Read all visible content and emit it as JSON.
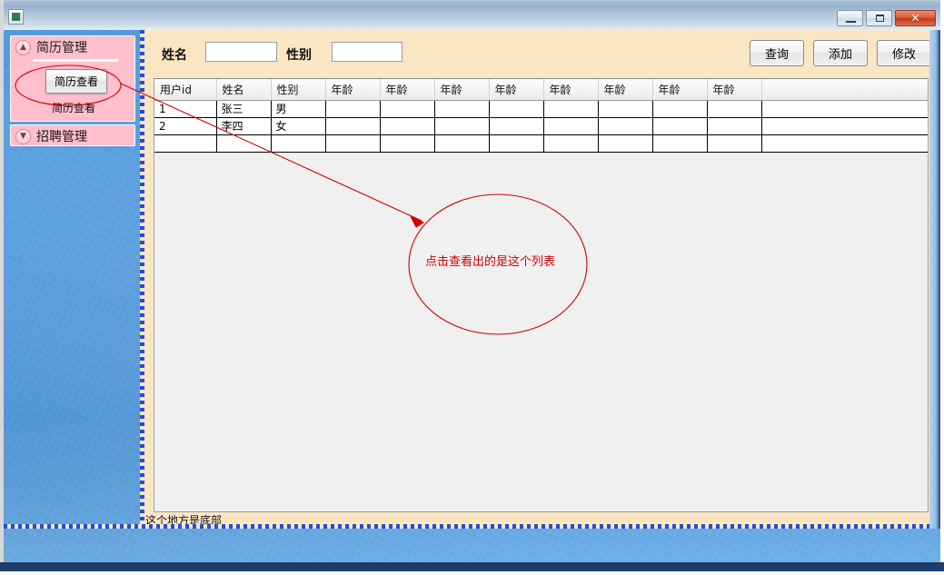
{
  "window": {
    "title": "",
    "icon": "window-app-icon",
    "controls": {
      "minimize": "–",
      "maximize": "□",
      "close": "✕"
    }
  },
  "sidebar": {
    "panels": [
      {
        "id": "resume-management",
        "title": "简历管理",
        "chevron": "▲",
        "expanded": true,
        "button_label": "简历查看",
        "caption_label": "简历查看"
      },
      {
        "id": "recruit-management",
        "title": "招聘管理",
        "chevron": "▼",
        "expanded": false
      }
    ]
  },
  "toolbar": {
    "fields": [
      {
        "label": "姓名",
        "value": "",
        "placeholder": ""
      },
      {
        "label": "性别",
        "value": "",
        "placeholder": ""
      }
    ],
    "buttons": [
      {
        "id": "query",
        "label": "查询"
      },
      {
        "id": "add",
        "label": "添加"
      },
      {
        "id": "edit",
        "label": "修改"
      }
    ]
  },
  "grid": {
    "columns": [
      {
        "key": "userid",
        "label": "用户id",
        "width": 68
      },
      {
        "key": "name",
        "label": "姓名",
        "width": 60
      },
      {
        "key": "gender",
        "label": "性别",
        "width": 60
      },
      {
        "key": "age1",
        "label": "年龄",
        "width": 60
      },
      {
        "key": "age2",
        "label": "年龄",
        "width": 60
      },
      {
        "key": "age3",
        "label": "年龄",
        "width": 60
      },
      {
        "key": "age4",
        "label": "年龄",
        "width": 60
      },
      {
        "key": "age5",
        "label": "年龄",
        "width": 60
      },
      {
        "key": "age6",
        "label": "年龄",
        "width": 60
      },
      {
        "key": "age7",
        "label": "年龄",
        "width": 60
      },
      {
        "key": "age8",
        "label": "年龄",
        "width": 60
      },
      {
        "key": "filler",
        "label": "",
        "width": 183
      }
    ],
    "rows": [
      {
        "userid": "1",
        "name": "张三",
        "gender": "男",
        "age1": "",
        "age2": "",
        "age3": "",
        "age4": "",
        "age5": "",
        "age6": "",
        "age7": "",
        "age8": "",
        "filler": ""
      },
      {
        "userid": "2",
        "name": "李四",
        "gender": "女",
        "age1": "",
        "age2": "",
        "age3": "",
        "age4": "",
        "age5": "",
        "age6": "",
        "age7": "",
        "age8": "",
        "filler": ""
      },
      {
        "userid": "",
        "name": "",
        "gender": "",
        "age1": "",
        "age2": "",
        "age3": "",
        "age4": "",
        "age5": "",
        "age6": "",
        "age7": "",
        "age8": "",
        "filler": ""
      }
    ]
  },
  "footer": {
    "text": "这个地方是底部"
  },
  "annotation": {
    "text": "点击查看出的是这个列表",
    "color": "#d40000"
  },
  "colors": {
    "panel_cream": "#fbe6c4",
    "sidebar_pink": "#ffbfcb",
    "desktop_blue": "#4d98dd",
    "grid_background": "#f0f0f0",
    "annotation_red": "#d40000"
  }
}
